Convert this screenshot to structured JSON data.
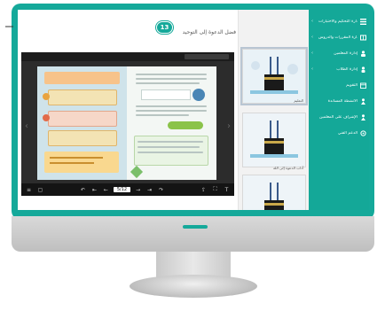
{
  "main": {
    "title": "فضل الدعوة إلى التوحيد",
    "step_badge": "13"
  },
  "sidebar": {
    "items": [
      {
        "label": "إدارة التحكيم والاختبارات",
        "icon": "list-icon",
        "has_chevron": true
      },
      {
        "label": "إدارة المقررات والدروس",
        "icon": "book-icon",
        "has_chevron": true
      },
      {
        "label": "إدارة المعلمين",
        "icon": "teacher-icon",
        "has_chevron": true
      },
      {
        "label": "إدارة الطلاب",
        "icon": "student-icon",
        "has_chevron": true
      },
      {
        "label": "التقويم",
        "icon": "calendar-icon",
        "has_chevron": false
      },
      {
        "label": "الأنشطة المساندة",
        "icon": "person-icon",
        "has_chevron": false
      },
      {
        "label": "الإشراف على المعلمين",
        "icon": "supervisor-icon",
        "has_chevron": false
      },
      {
        "label": "الدعم الفني",
        "icon": "support-icon",
        "has_chevron": false
      }
    ]
  },
  "thumbnails": [
    {
      "caption": "التعليم"
    },
    {
      "caption": "آداب الدعوة إلى الله"
    },
    {
      "caption": ""
    }
  ],
  "viewer": {
    "page_indicator": "5/12"
  },
  "colors": {
    "brand": "#15a99a",
    "viewer_bg": "#2c2c2c",
    "toolbar_bg": "#141414"
  }
}
